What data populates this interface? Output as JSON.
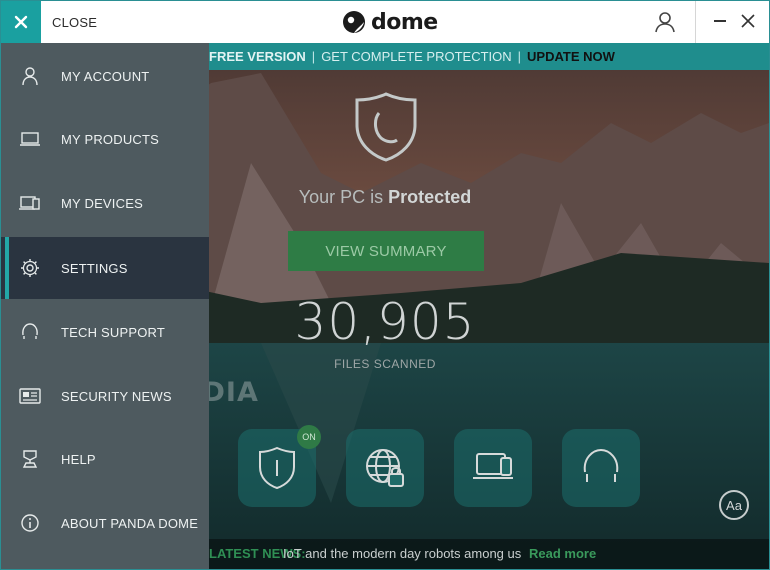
{
  "titlebar": {
    "close_label": "CLOSE",
    "logo_text": "dome",
    "logo_small": "panda"
  },
  "promo": {
    "free_version": "FREE VERSION",
    "get_protection": "GET COMPLETE PROTECTION",
    "update_now": "UPDATE NOW"
  },
  "status": {
    "prefix": "Your PC is",
    "state": "Protected",
    "view_summary": "VIEW SUMMARY",
    "files_scanned_count": "30,905",
    "files_scanned_label": "FILES SCANNED"
  },
  "tiles": {
    "on_badge": "ON"
  },
  "font_button": "Aa",
  "watermark": "SOFTPEDIA",
  "news": {
    "label": "LATEST NEWS:",
    "headline": "IoT and the modern day robots among us",
    "link": "Read more"
  },
  "menu": {
    "items": [
      {
        "label": "MY ACCOUNT",
        "icon": "user-icon"
      },
      {
        "label": "MY PRODUCTS",
        "icon": "laptop-icon"
      },
      {
        "label": "MY DEVICES",
        "icon": "devices-icon"
      },
      {
        "label": "SETTINGS",
        "icon": "gear-icon",
        "active": true
      },
      {
        "label": "TECH SUPPORT",
        "icon": "headset-icon"
      },
      {
        "label": "SECURITY NEWS",
        "icon": "news-icon"
      },
      {
        "label": "HELP",
        "icon": "help-icon"
      },
      {
        "label": "ABOUT PANDA DOME",
        "icon": "info-icon"
      }
    ]
  },
  "colors": {
    "accent_teal": "#1aa0a0",
    "menu_bg": "#4e5a5f",
    "menu_active": "#2a3440",
    "button_green": "#2e7c45"
  }
}
